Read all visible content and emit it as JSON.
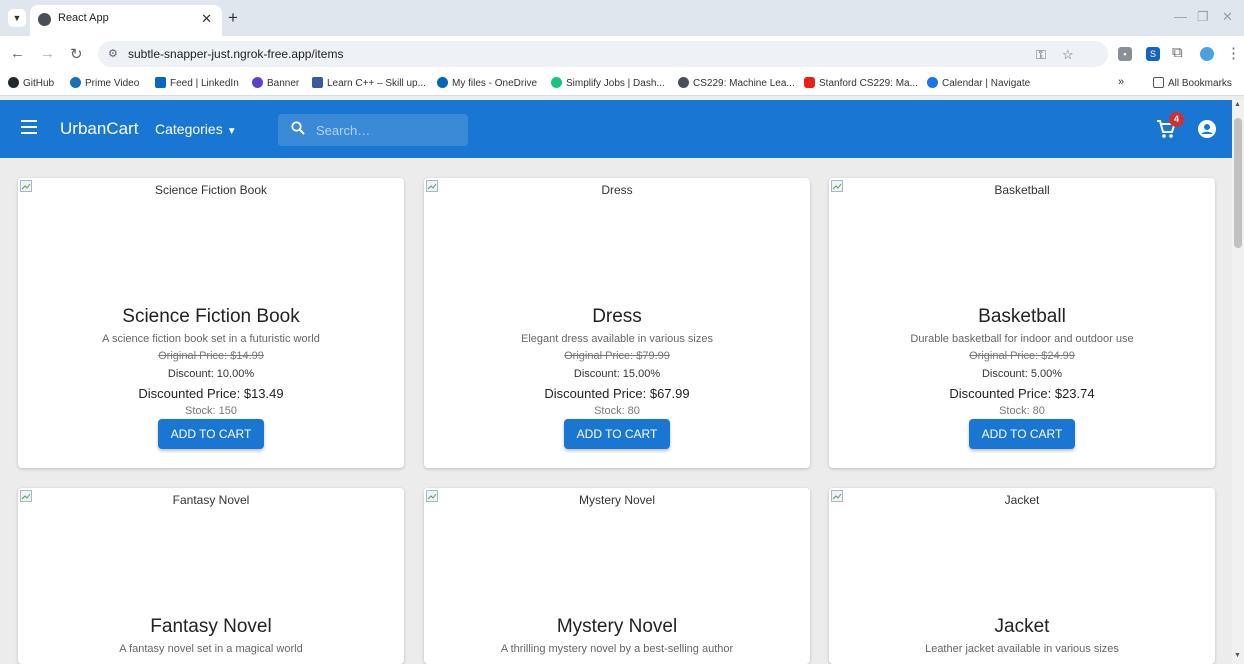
{
  "browser": {
    "tab_title": "React App",
    "url": "subtle-snapper-just.ngrok-free.app/items",
    "bookmarks": [
      {
        "label": "GitHub",
        "color": "#24292e"
      },
      {
        "label": "Prime Video",
        "color": "#1a6fb5"
      },
      {
        "label": "Feed | LinkedIn",
        "color": "#0a66c2"
      },
      {
        "label": "Banner",
        "color": "#5c3fd0"
      },
      {
        "label": "Learn C++ – Skill up...",
        "color": "#3a5a99"
      },
      {
        "label": "My files - OneDrive",
        "color": "#0364b8"
      },
      {
        "label": "Simplify Jobs | Dash...",
        "color": "#1bc47d"
      },
      {
        "label": "CS229: Machine Lea...",
        "color": "#4a4f55"
      },
      {
        "label": "Stanford CS229: Ma...",
        "color": "#e62117"
      },
      {
        "label": "Calendar | Navigate",
        "color": "#1a73e8"
      }
    ],
    "more_bookmarks": "»",
    "all_bookmarks": "All Bookmarks"
  },
  "header": {
    "brand": "UrbanCart",
    "categories_label": "Categories",
    "search_placeholder": "Search…",
    "cart_count": "4",
    "accent_color": "#1976d2"
  },
  "items": [
    {
      "image_alt": "Science Fiction Book",
      "name": "Science Fiction Book",
      "description": "A science fiction book set in a futuristic world",
      "original_price": "Original Price: $14.99",
      "discount": "Discount: 10.00%",
      "discounted_price": "Discounted Price: $13.49",
      "stock": "Stock: 150",
      "button": "ADD TO CART"
    },
    {
      "image_alt": "Dress",
      "name": "Dress",
      "description": "Elegant dress available in various sizes",
      "original_price": "Original Price: $79.99",
      "discount": "Discount: 15.00%",
      "discounted_price": "Discounted Price: $67.99",
      "stock": "Stock: 80",
      "button": "ADD TO CART"
    },
    {
      "image_alt": "Basketball",
      "name": "Basketball",
      "description": "Durable basketball for indoor and outdoor use",
      "original_price": "Original Price: $24.99",
      "discount": "Discount: 5.00%",
      "discounted_price": "Discounted Price: $23.74",
      "stock": "Stock: 80",
      "button": "ADD TO CART"
    },
    {
      "image_alt": "Fantasy Novel",
      "name": "Fantasy Novel",
      "description": "A fantasy novel set in a magical world"
    },
    {
      "image_alt": "Mystery Novel",
      "name": "Mystery Novel",
      "description": "A thrilling mystery novel by a best-selling author"
    },
    {
      "image_alt": "Jacket",
      "name": "Jacket",
      "description": "Leather jacket available in various sizes"
    }
  ]
}
